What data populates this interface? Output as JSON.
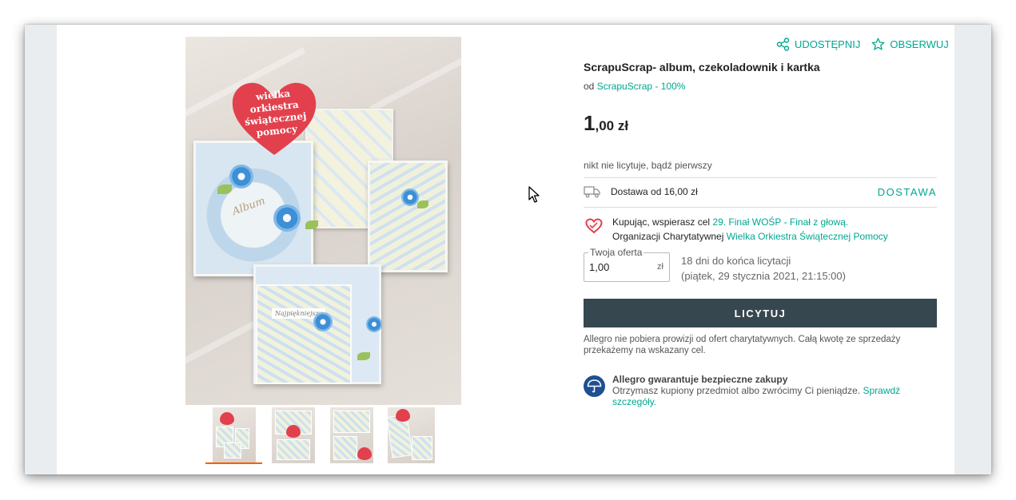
{
  "header_actions": {
    "share_label": "UDOSTĘPNIJ",
    "watch_label": "OBSERWUJ"
  },
  "product": {
    "title": "ScrapuScrap- album, czekoladownik i kartka",
    "seller_prefix": "od",
    "seller_name": "ScrapuScrap - 100%",
    "price_integer": "1",
    "price_decimal": ",00 zł",
    "bid_status": "nikt nie licytuje, bądź pierwszy"
  },
  "photo": {
    "heart_text_line1": "wielka orkiestra",
    "heart_text_line2": "świątecznej",
    "heart_text_line3": "pomocy",
    "album_text": "Album",
    "card_text": "Najpiękniejszy"
  },
  "delivery": {
    "text": "Dostawa od 16,00 zł",
    "link_label": "DOSTAWA"
  },
  "charity": {
    "line1_prefix": "Kupując, wspierasz cel",
    "line1_link": "29. Finał WOŚP - Finał z głową.",
    "line2_prefix": "Organizacji Charytatywnej",
    "line2_link": "Wielka Orkiestra Świątecznej Pomocy"
  },
  "offer": {
    "legend": "Twoja oferta",
    "value": "1,00",
    "unit": "zł",
    "time_left": "18 dni do końca licytacji",
    "end_date": "(piątek, 29 stycznia 2021, 21:15:00)"
  },
  "bid_button_label": "LICYTUJ",
  "no_fee_text": "Allegro nie pobiera prowizji od ofert charytatywnych. Całą kwotę ze sprzedaży przekażemy na wskazany cel.",
  "guarantee": {
    "title": "Allegro gwarantuje bezpieczne zakupy",
    "text": "Otrzymasz kupiony przedmiot albo zwrócimy Ci pieniądze.",
    "link": "Sprawdź szczegóły."
  },
  "colors": {
    "accent": "#00a790",
    "button": "#37474f",
    "heart_red": "#e2404d",
    "guarantee_blue": "#1e4f93",
    "thumb_active": "#ff5a00"
  },
  "icons": [
    "share-icon",
    "star-icon",
    "delivery-truck-icon",
    "charity-heart-icon",
    "umbrella-icon",
    "mouse-cursor-icon"
  ]
}
